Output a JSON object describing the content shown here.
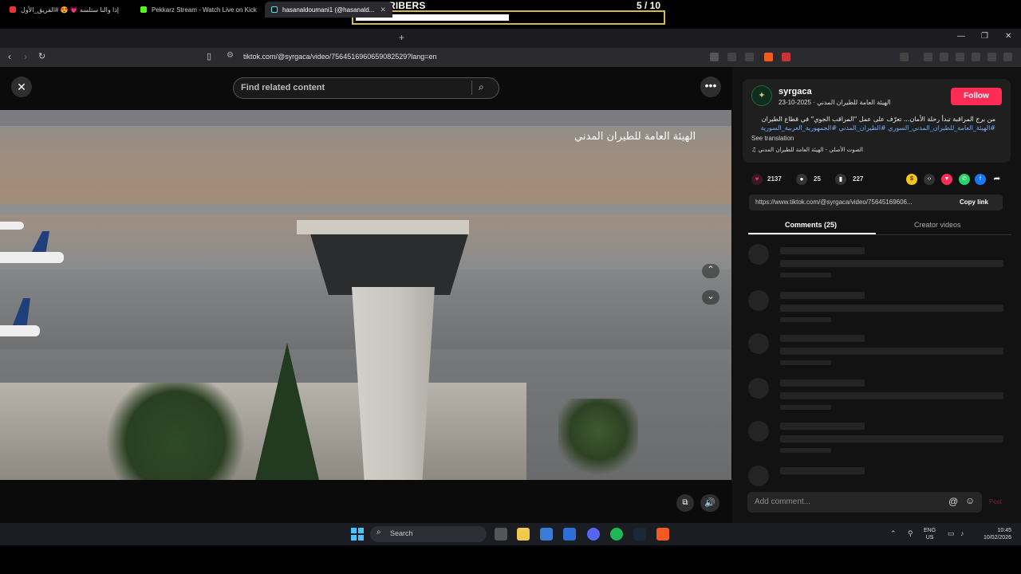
{
  "overlay": {
    "label": "SUBSCRIBERS",
    "count": "5  / 10",
    "progress": 0.5
  },
  "browser": {
    "tabs": [
      {
        "label": "إذا والنا ستلسه 💗 😍 #الفريق_الأول"
      },
      {
        "label": "Pekkarz Stream - Watch Live on Kick"
      },
      {
        "label": "hasanaldoumani1 (@hasanald..."
      }
    ],
    "url": "tiktok.com/@syrgaca/video/7564516960659082529?lang=en"
  },
  "video_page": {
    "search_placeholder": "Find related content",
    "logo_text": "الهيئة العامة للطيران المدني"
  },
  "post": {
    "username": "syrgaca",
    "subline": "الهيئة العامة للطيران المدني · 2025-10-23",
    "follow_label": "Follow",
    "description": "من برج المراقبة تبدأ رحلة الأمان... تعرّف على عمل \"المراقب الجوي\" في قطاع الطيران",
    "hashtags": "#الهيئة_العامة_للطيران_المدني_السوري #الطيران_المدني #الجمهورية_العربية_السورية",
    "see_translation": "See translation",
    "music": "الصوت الأصلي - الهيئة العامة للطيران المدني",
    "likes": "2137",
    "comments": "25",
    "saves": "227",
    "link": "https://www.tiktok.com/@syrgaca/video/75645169606...",
    "copy_link_label": "Copy link",
    "tab_comments": "Comments (25)",
    "tab_creator": "Creator videos",
    "comment_placeholder": "Add comment...",
    "post_label": "Post"
  },
  "taskbar": {
    "search_label": "Search",
    "lang": "ENG",
    "region": "US",
    "time": "10:45",
    "date": "10/02/2026"
  },
  "colors": {
    "accent": "#fe2c55",
    "overlay_border": "#d9b84a"
  }
}
